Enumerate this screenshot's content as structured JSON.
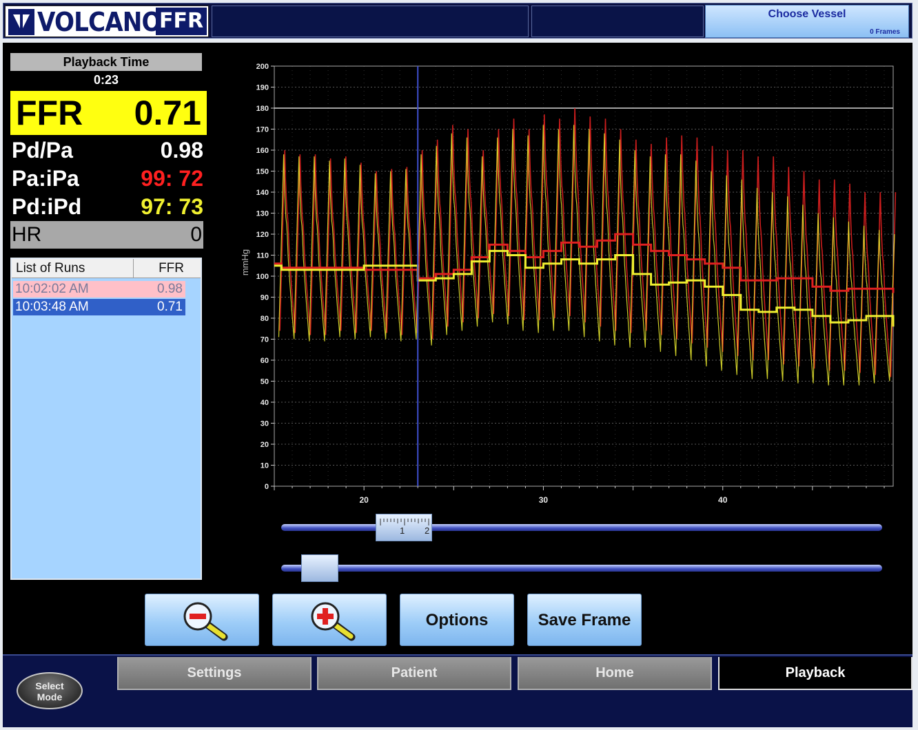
{
  "header": {
    "logo_text": "VOLCANO",
    "logo_ffr": "FFR",
    "choose_vessel_label": "Choose Vessel",
    "frames_label": "0 Frames"
  },
  "readouts": {
    "playback_time_label": "Playback Time",
    "playback_time": "0:23",
    "ffr_label": "FFR",
    "ffr_value": "0.71",
    "pdpa_label": "Pd/Pa",
    "pdpa_value": "0.98",
    "paipa_label": "Pa:iPa",
    "paipa_value": "99: 72",
    "pdipd_label": "Pd:iPd",
    "pdipd_value": "97: 73",
    "hr_label": "HR",
    "hr_value": "0"
  },
  "runs": {
    "col_time": "List of Runs",
    "col_ffr": "FFR",
    "items": [
      {
        "time": "10:02:02 AM",
        "ffr": "0.98",
        "selected": false
      },
      {
        "time": "10:03:48 AM",
        "ffr": "0.71",
        "selected": true
      }
    ]
  },
  "toolbar": {
    "zoom_out_icon": "zoom-out-magnifier-icon",
    "zoom_in_icon": "zoom-in-magnifier-icon",
    "options_label": "Options",
    "save_frame_label": "Save Frame"
  },
  "sliders": {
    "ruler_position": 0.204,
    "ruler_ticks": [
      "1",
      "2"
    ],
    "scroll_position": 0.064
  },
  "tabs": [
    {
      "label": "Settings",
      "active": false
    },
    {
      "label": "Patient",
      "active": false
    },
    {
      "label": "Home",
      "active": false
    },
    {
      "label": "Playback",
      "active": true
    }
  ],
  "select_mode_label": "Select Mode",
  "colors": {
    "pa_trace": "#e02020",
    "pd_trace": "#f0f030",
    "ffr_highlight": "#ffff10",
    "cursor": "#4050d0"
  },
  "chart_data": {
    "type": "line",
    "ylabel": "mmHg",
    "ylim": [
      0,
      200
    ],
    "yticks": [
      0,
      10,
      20,
      30,
      40,
      50,
      60,
      70,
      80,
      90,
      100,
      110,
      120,
      130,
      140,
      150,
      160,
      170,
      180,
      190,
      200
    ],
    "xlim": [
      15,
      49.5
    ],
    "xticks": [
      20,
      30,
      40
    ],
    "cursor_x": 23,
    "grid": true,
    "reference_line_y": 180,
    "series": [
      {
        "name": "Pa mean",
        "color": "#e02020",
        "x": [
          15,
          15.4,
          16,
          20,
          23,
          24,
          25,
          26,
          27,
          28,
          29,
          30,
          31,
          32,
          33,
          34,
          35,
          36,
          37,
          38,
          39,
          40,
          41,
          42,
          43,
          44,
          45,
          46,
          47,
          48,
          49.5
        ],
        "values": [
          106,
          104,
          104,
          103,
          99,
          101,
          103,
          109,
          115,
          112,
          109,
          112,
          116,
          114,
          117,
          120,
          115,
          112,
          110,
          108,
          106,
          104,
          98,
          98,
          99,
          99,
          95,
          93,
          94,
          94,
          92
        ]
      },
      {
        "name": "Pd mean",
        "color": "#f0f030",
        "x": [
          15,
          15.4,
          16,
          20,
          23,
          24,
          25,
          26,
          27,
          28,
          29,
          30,
          31,
          32,
          33,
          34,
          35,
          36,
          37,
          38,
          39,
          40,
          41,
          42,
          43,
          44,
          45,
          46,
          47,
          48,
          49.5
        ],
        "values": [
          105,
          103,
          103,
          105,
          98,
          99,
          101,
          107,
          112,
          110,
          104,
          106,
          108,
          106,
          108,
          110,
          101,
          96,
          97,
          98,
          95,
          91,
          84,
          83,
          85,
          84,
          81,
          78,
          79,
          81,
          76
        ]
      },
      {
        "name": "Pa peaks",
        "color": "#e02020",
        "values": [
          160,
          158,
          158,
          156,
          157,
          154,
          150,
          151,
          152,
          160,
          165,
          172,
          170,
          160,
          170,
          175,
          170,
          177,
          175,
          180,
          176,
          175,
          170,
          165,
          163,
          166,
          167,
          166,
          162,
          160,
          160,
          157,
          157,
          152,
          150,
          146,
          146,
          144,
          140,
          140,
          140
        ]
      },
      {
        "name": "Pd peaks",
        "color": "#f0f030",
        "values": [
          158,
          157,
          157,
          155,
          156,
          153,
          149,
          150,
          151,
          158,
          162,
          168,
          166,
          157,
          166,
          170,
          167,
          172,
          170,
          172,
          170,
          168,
          165,
          160,
          157,
          158,
          158,
          155,
          150,
          148,
          146,
          142,
          140,
          138,
          134,
          130,
          128,
          126,
          124,
          122,
          120
        ]
      },
      {
        "name": "Pa troughs",
        "color": "#e02020",
        "values": [
          74,
          73,
          72,
          72,
          74,
          73,
          74,
          73,
          72,
          73,
          70,
          76,
          78,
          80,
          82,
          81,
          79,
          79,
          80,
          81,
          78,
          76,
          74,
          73,
          74,
          72,
          70,
          68,
          66,
          64,
          62,
          60,
          60,
          58,
          57,
          56,
          55,
          55,
          54,
          53,
          52
        ]
      },
      {
        "name": "Pd troughs",
        "color": "#f0f030",
        "values": [
          71,
          70,
          69,
          69,
          71,
          70,
          71,
          70,
          69,
          70,
          67,
          72,
          74,
          76,
          78,
          77,
          74,
          73,
          74,
          74,
          71,
          69,
          67,
          66,
          66,
          64,
          62,
          60,
          57,
          55,
          53,
          51,
          51,
          50,
          49,
          49,
          48,
          48,
          48,
          49,
          50
        ]
      }
    ]
  }
}
